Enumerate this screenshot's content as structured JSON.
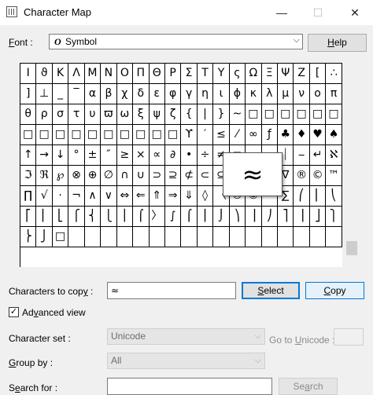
{
  "window": {
    "title": "Character Map",
    "min_glyph": "—",
    "max_glyph": "☐",
    "close_glyph": "✕"
  },
  "font": {
    "label_main": "ont :",
    "label_key": "F",
    "icon_glyph": "O",
    "value": "Symbol",
    "help_key": "H",
    "help_rest": "elp"
  },
  "grid": {
    "rows": [
      [
        "Ι",
        "ϑ",
        "Κ",
        "Λ",
        "Μ",
        "Ν",
        "Ο",
        "Π",
        "Θ",
        "Ρ",
        "Σ",
        "Τ",
        "Υ",
        "ς",
        "Ω",
        "Ξ",
        "Ψ",
        "Ζ",
        "[",
        "∴"
      ],
      [
        "]",
        "⊥",
        "_",
        "‾",
        "α",
        "β",
        "χ",
        "δ",
        "ε",
        "φ",
        "γ",
        "η",
        "ι",
        "ϕ",
        "κ",
        "λ",
        "μ",
        "ν",
        "ο",
        "π"
      ],
      [
        "θ",
        "ρ",
        "σ",
        "τ",
        "υ",
        "ϖ",
        "ω",
        "ξ",
        "ψ",
        "ζ",
        "{",
        "|",
        "}",
        "~",
        "□",
        "□",
        "□",
        "□",
        "□",
        "□"
      ],
      [
        "□",
        "□",
        "□",
        "□",
        "□",
        "□",
        "□",
        "□",
        "□",
        "□",
        "ϒ",
        "′",
        "≤",
        "⁄",
        "∞",
        "ƒ",
        "♣",
        "♦",
        "♥",
        "♠",
        "↔",
        "←"
      ],
      [
        "↑",
        "→",
        "↓",
        "°",
        "±",
        "″",
        "≥",
        "×",
        "∝",
        "∂",
        "•",
        "÷",
        "≠",
        "≡",
        "≈",
        "…",
        "⏐",
        "⎯",
        "↵",
        "ℵ"
      ],
      [
        "ℑ",
        "ℜ",
        "℘",
        "⊗",
        "⊕",
        "∅",
        "∩",
        "∪",
        "⊃",
        "⊇",
        "⊄",
        "⊂",
        "⊆",
        "∈",
        "∉",
        "∠",
        "∇",
        "®",
        "©",
        "™"
      ],
      [
        "∏",
        "√",
        "⋅",
        "¬",
        "∧",
        "∨",
        "⇔",
        "⇐",
        "⇑",
        "⇒",
        "⇓",
        "◊",
        "〈",
        "®",
        "©",
        "™",
        "∑",
        "⎛",
        "⎜",
        "⎝"
      ],
      [
        "⎡",
        "⎢",
        "⎣",
        "⎧",
        "⎨",
        "⎩",
        "⎪",
        "⌠",
        "〉",
        "∫",
        "⌠",
        "⎮",
        "⌡",
        "⎞",
        "⎟",
        "⎠",
        "⎤",
        "⎥",
        "⎦",
        "⎫"
      ],
      [
        "⎬",
        "⎭",
        "□",
        "",
        "",
        "",
        "",
        "",
        "",
        "",
        "",
        "",
        "",
        "",
        "",
        "",
        "",
        "",
        "",
        ""
      ]
    ],
    "zoom_char": "≈"
  },
  "copy": {
    "label_pre": "Characters to cop",
    "label_key": "y",
    "label_post": " :",
    "value": "≈",
    "select_key": "S",
    "select_rest": "elect",
    "copy_key": "C",
    "copy_rest": "opy"
  },
  "advanced": {
    "check": "✓",
    "label_pre": "Ad",
    "label_key": "v",
    "label_post": "anced view"
  },
  "charset": {
    "label_pre": "C",
    "label_mid": "haracter set :",
    "value": "Unicode",
    "goto_pre": "Go to ",
    "goto_key": "U",
    "goto_post": "nicode :"
  },
  "groupby": {
    "label_key": "G",
    "label_post": "roup by :",
    "value": "All"
  },
  "search": {
    "label_pre": "S",
    "label_key": "e",
    "label_post": "arch for :",
    "button_pre": "Se",
    "button_key": "a",
    "button_post": "rch"
  }
}
